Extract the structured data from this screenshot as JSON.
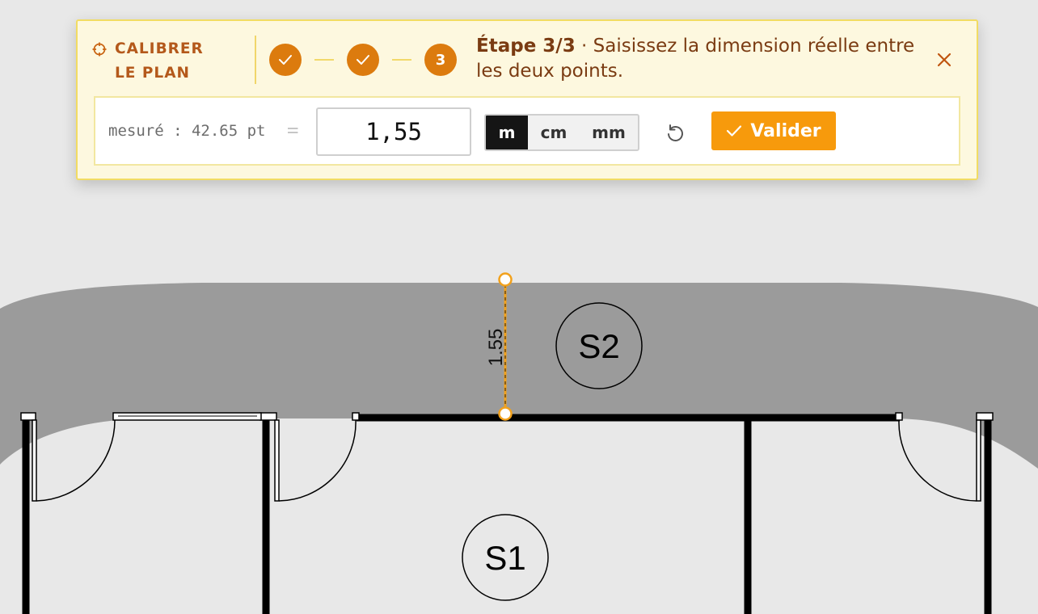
{
  "calibration_panel": {
    "title": "CALIBRER LE PLAN",
    "steps": [
      {
        "label": "",
        "state": "done"
      },
      {
        "label": "",
        "state": "done"
      },
      {
        "label": "3",
        "state": "current"
      }
    ],
    "instruction_step": "Étape 3/3",
    "instruction_sep": " · ",
    "instruction_text": "Saisissez la dimension réelle entre les deux points.",
    "measured_label": "mesuré : 42.65 pt",
    "equals": "=",
    "value": "1,55",
    "units": [
      "m",
      "cm",
      "mm"
    ],
    "selected_unit": "m",
    "validate_label": "Valider",
    "icons": {
      "title": "crosshair-icon",
      "step_done": "check-icon",
      "close": "close-icon",
      "reset": "reset-icon",
      "validate": "check-icon"
    },
    "colors": {
      "accent": "#f79a0c",
      "step": "#dc7b0e",
      "panel_bg": "#fdf8df",
      "panel_border": "#f2dc63",
      "title_text": "#b4591b",
      "instruction_text": "#7a3b12"
    }
  },
  "plan": {
    "room_labels": [
      "S1",
      "S2"
    ],
    "dimension_label": "1.55",
    "colors": {
      "wall": "#000000",
      "corridor": "#9b9b9b",
      "background": "#e8e8e8",
      "measure_line": "#f2a11c"
    }
  }
}
